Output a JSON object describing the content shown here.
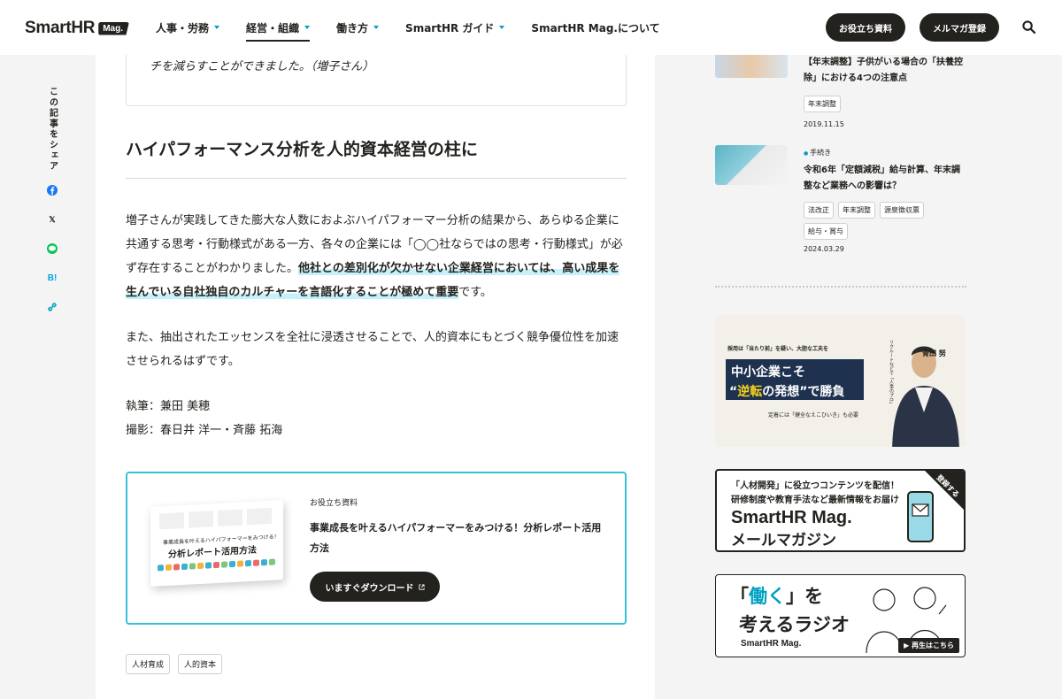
{
  "header": {
    "logo_text": "SmartHR",
    "logo_badge": "Mag.",
    "nav": [
      {
        "label": "人事・労務"
      },
      {
        "label": "経営・組織"
      },
      {
        "label": "働き方"
      },
      {
        "label": "SmartHR ガイド"
      },
      {
        "label": "SmartHR Mag.について"
      }
    ],
    "btn_resources": "お役立ち資料",
    "btn_newsletter": "メルマガ登録",
    "search_icon": "search-icon"
  },
  "share": {
    "label": "この記事をシェア",
    "icons": [
      "facebook-icon",
      "x-icon",
      "line-icon",
      "hatena-icon",
      "link-icon"
    ],
    "x_glyph": "𝕏",
    "hatena_glyph": "B!",
    "link_glyph": "🔗",
    "colors": {
      "facebook": "#1877f2",
      "line": "#06c755",
      "hatena": "#00a4de",
      "link": "#00a0c3"
    }
  },
  "article": {
    "quote_tail": "チを減らすことができました。（増子さん）",
    "heading": "ハイパフォーマンス分析を人的資本経営の柱に",
    "para1_plain": "増子さんが実践してきた膨大な人数におよぶハイパフォーマー分析の結果から、あらゆる企業に共通する思考・行動様式がある一方、各々の企業には「◯◯社ならではの思考・行動様式」が必ず存在することがわかりました。",
    "para1_highlight": "他社との差別化が欠かせない企業経営においては、高い成果を生んでいる自社独自のカルチャーを言語化することが極めて重要",
    "para1_end": "です。",
    "para2": "また、抽出されたエッセンスを全社に浸透させることで、人的資本にもとづく競争優位性を加速させられるはずです。",
    "writer": "執筆：兼田 美穂",
    "photographer": "撮影：春日井 洋一・斉藤 拓海",
    "accent_color": "#39c0d8",
    "highlight_color": "#c6f0fb"
  },
  "cta": {
    "label": "お役立ち資料",
    "title": "事業成長を叶えるハイパフォーマーをみつける！分析レポート活用方法",
    "button": "いますぐダウンロード",
    "button_icon": "external-link-icon",
    "thumb_small": "事業成長を叶えるハイパフォーマーをみつける！",
    "thumb_big": "分析レポート活用方法"
  },
  "tags": [
    "人材育成",
    "人的資本"
  ],
  "sidebar": {
    "articles": [
      {
        "category": "",
        "title": "【年末調整】子供がいる場合の「扶養控除」における4つの注意点",
        "tags": [
          "年末調整"
        ],
        "date": "2019.11.15"
      },
      {
        "category": "手続き",
        "title": "令和6年「定額減税」給与計算、年末調整など業務への影響は？",
        "tags": [
          "法改正",
          "年末調整",
          "源泉徴収票",
          "給与・賞与"
        ],
        "date": "2024.03.29"
      }
    ],
    "banner1": {
      "top": "採用は「当たり前」を疑い、大胆な工夫を",
      "line1": "中小企業こそ",
      "line2a": "“",
      "line2b": "逆転",
      "line2c": "の発想”で勝負",
      "bottom": "定着には「健全なえこひいき」も必要",
      "name": "青田 努",
      "vertical": "リクルートなどで「人事のプロ」"
    },
    "banner2": {
      "line1": "「人材開発」に役立つコンテンツを配信！",
      "line2": "研修制度や教育手法など最新情報をお届け",
      "line3": "SmartHR Mag.",
      "line4": "メールマガジン",
      "corner": "登録する"
    },
    "banner3": {
      "line1a": "「",
      "line1b": "働く",
      "line1c": "」を",
      "line2": "考えるラジオ",
      "logo": "SmartHR Mag.",
      "play": "▶ 再生はこちら"
    }
  }
}
